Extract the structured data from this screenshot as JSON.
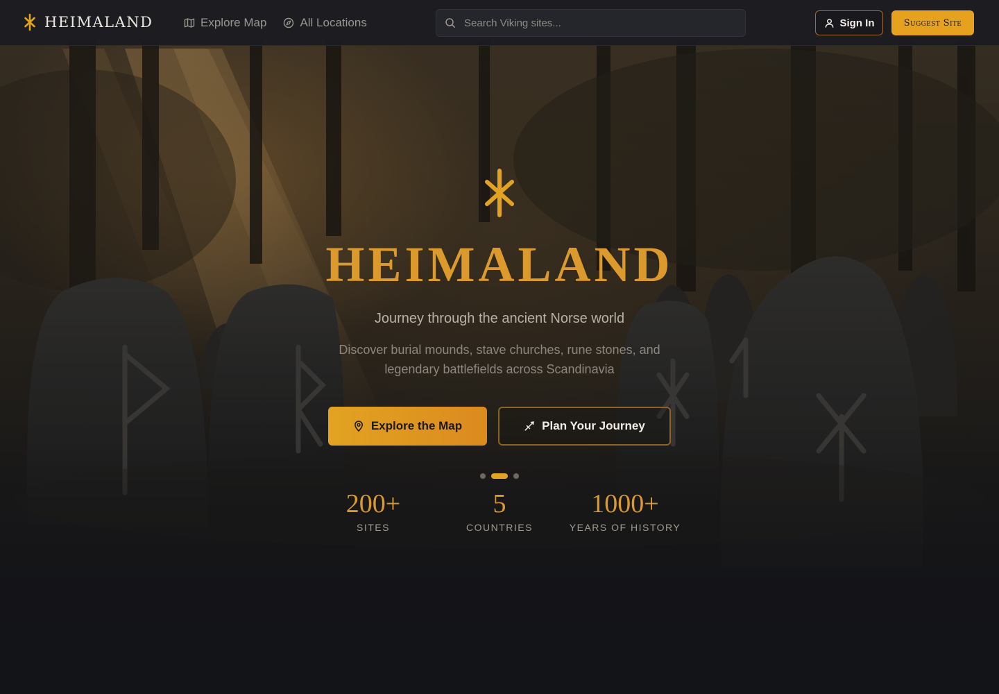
{
  "brand": {
    "name": "HEIMALAND",
    "accent": "#e2a322"
  },
  "nav": {
    "links": [
      {
        "label": "Explore Map",
        "icon": "map-icon"
      },
      {
        "label": "All Locations",
        "icon": "compass-icon"
      }
    ],
    "search": {
      "placeholder": "Search Viking sites...",
      "value": ""
    },
    "sign_in": {
      "label": "Sign In",
      "icon": "user-icon"
    },
    "suggest": {
      "label": "Suggest Site"
    }
  },
  "hero": {
    "emblem_icon": "rune-emblem-icon",
    "title": "HEIMALAND",
    "subtitle": "Journey through the ancient Norse world",
    "description": "Discover burial mounds, stave churches, rune stones, and legendary battlefields across Scandinavia",
    "primary_button": {
      "label": "Explore the Map",
      "icon": "map-pin-icon"
    },
    "secondary_button": {
      "label": "Plan Your Journey",
      "icon": "sword-icon"
    },
    "carousel": {
      "count": 3,
      "active_index": 1
    },
    "stats": [
      {
        "value": "200+",
        "label": "SITES"
      },
      {
        "value": "5",
        "label": "COUNTRIES"
      },
      {
        "value": "1000+",
        "label": "YEARS OF HISTORY"
      }
    ]
  },
  "colors": {
    "gold": "#e2a322",
    "gold_text": "#dc9a2c",
    "navbar_bg": "#1a1b21",
    "page_bg": "#16171d"
  }
}
